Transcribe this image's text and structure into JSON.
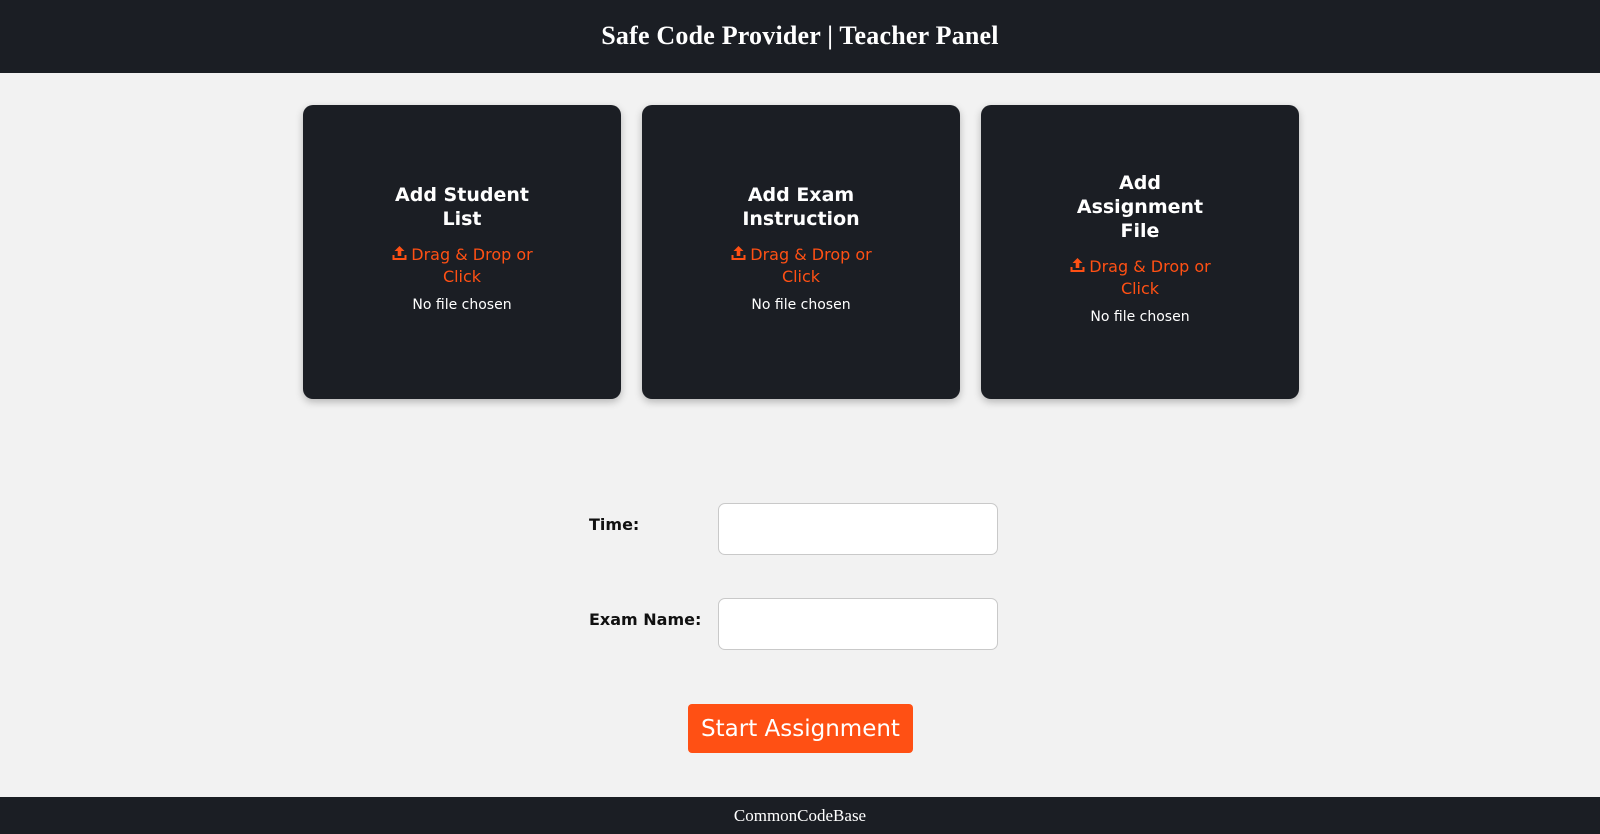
{
  "header": {
    "title": "Safe Code Provider | Teacher Panel"
  },
  "cards": [
    {
      "title": "Add Student List",
      "upload_label": "Drag & Drop or Click",
      "file_status": "No file chosen",
      "icon": "upload-icon"
    },
    {
      "title": "Add Exam Instruction",
      "upload_label": "Drag & Drop or Click",
      "file_status": "No file chosen",
      "icon": "upload-icon"
    },
    {
      "title": "Add Assignment File",
      "upload_label": "Drag & Drop or Click",
      "file_status": "No file chosen",
      "icon": "upload-icon"
    }
  ],
  "form": {
    "time_label": "Time:",
    "time_value": "",
    "exam_name_label": "Exam Name:",
    "exam_name_value": ""
  },
  "actions": {
    "start_label": "Start Assignment"
  },
  "footer": {
    "text": "CommonCodeBase"
  },
  "colors": {
    "dark": "#1b1e24",
    "accent": "#ff5014",
    "background": "#f2f2f2"
  }
}
